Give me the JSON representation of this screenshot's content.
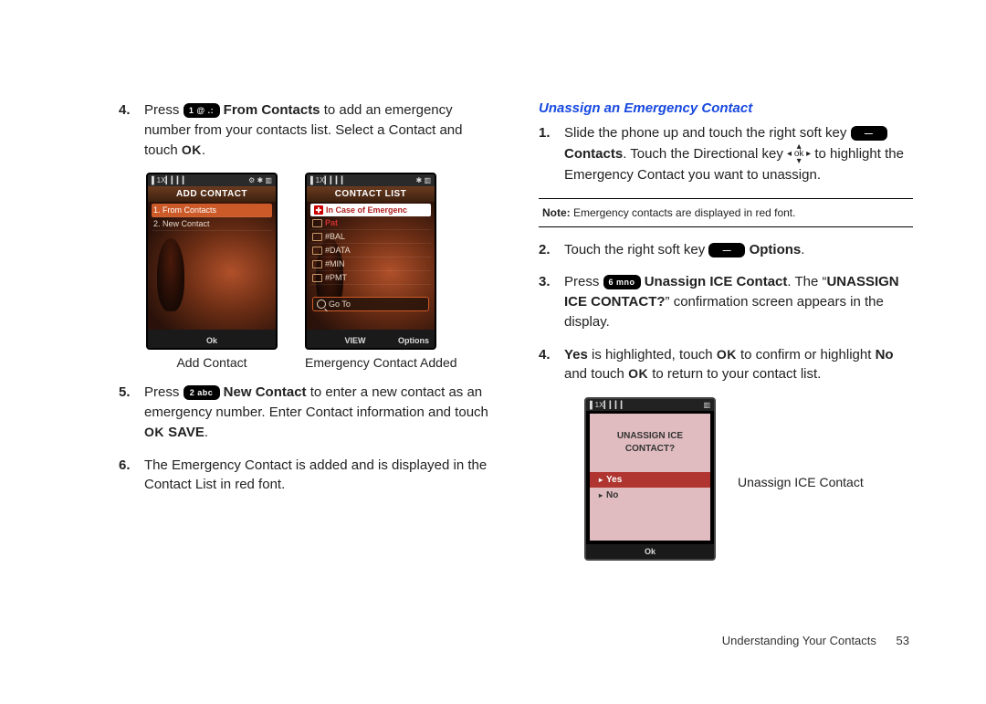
{
  "left": {
    "step4": {
      "num": "4.",
      "a": "Press ",
      "key1": "1 @ .:",
      "b": " From Contacts",
      "c": " to add an emergency number from your contacts list. Select a Contact and touch ",
      "ok": "OK",
      "d": "."
    },
    "phoneA": {
      "status_l": "▌1X▎▎▎▎",
      "status_r": "⚙  ✱   ▥",
      "title": "ADD CONTACT",
      "items": [
        "1. From Contacts",
        "2. New Contact"
      ],
      "soft_l": "",
      "soft_c": "Ok",
      "soft_r": "",
      "caption": "Add Contact"
    },
    "phoneB": {
      "status_l": "▌1X▎▎▎▎",
      "status_r": "✱   ▥",
      "title": "CONTACT LIST",
      "header": "In Case of Emergenc",
      "items": [
        "Pat",
        "#BAL",
        "#DATA",
        "#MIN",
        "#PMT"
      ],
      "goto": "Go To",
      "soft_l": "",
      "soft_c": "VIEW",
      "soft_r": "Options",
      "caption": "Emergency Contact Added"
    },
    "step5": {
      "num": "5.",
      "a": "Press ",
      "key1": "2 abc",
      "b": " New Contact",
      "c": " to enter a new contact as an emergency number. Enter Contact information and touch ",
      "ok": "OK",
      "save": " SAVE",
      "d": "."
    },
    "step6": {
      "num": "6.",
      "a": "The Emergency Contact is added and is displayed in the Contact List in red font."
    }
  },
  "right": {
    "heading": "Unassign an Emergency Contact",
    "step1": {
      "num": "1.",
      "a": "Slide the phone up and touch the right soft key ",
      "key1": "—",
      "b": " Contacts",
      "c": ". Touch the Directional key ",
      "d": " to highlight the Emergency Contact you want to unassign."
    },
    "note": {
      "label": "Note:",
      "text": " Emergency contacts are displayed in red font."
    },
    "step2": {
      "num": "2.",
      "a": "Touch the right soft key ",
      "key1": "—",
      "b": " Options",
      "c": "."
    },
    "step3": {
      "num": "3.",
      "a": "Press ",
      "key1": "6 mno",
      "b": " Unassign ICE Contact",
      "c": ". The “",
      "d": "UNASSIGN ICE CONTACT?",
      "e": "” confirmation screen appears in the display."
    },
    "step4": {
      "num": "4.",
      "a": "Yes",
      "b": " is highlighted, touch ",
      "ok1": "OK",
      "c": " to confirm or highlight ",
      "no": "No",
      "d": " and touch ",
      "ok2": "OK",
      "e": " to return to your contact list."
    },
    "phoneC": {
      "status_l": "▌1X▎▎▎▎",
      "status_r": "▥",
      "q1": "UNASSIGN ICE",
      "q2": "CONTACT?",
      "yes": "Yes",
      "no": "No",
      "soft_c": "Ok",
      "caption": "Unassign ICE Contact"
    }
  },
  "footer": {
    "section": "Understanding Your Contacts",
    "page": "53"
  },
  "dirkey": "◂ ok ▸"
}
